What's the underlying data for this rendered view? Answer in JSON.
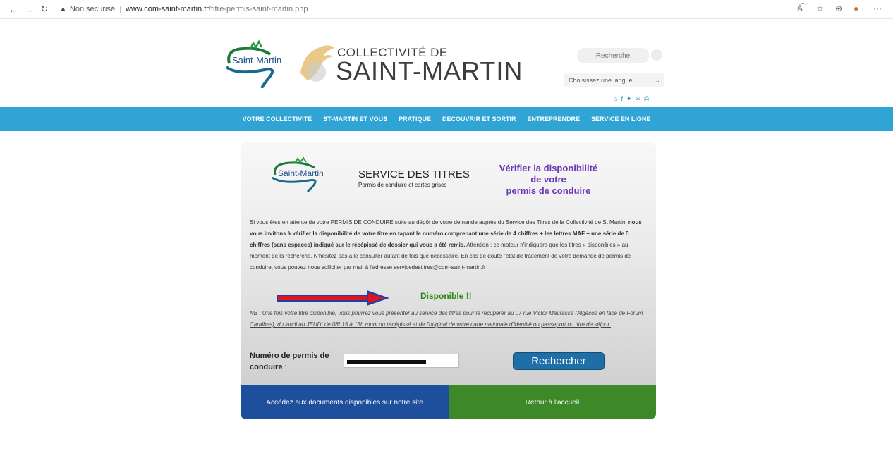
{
  "browser": {
    "security_label": "Non sécurisé",
    "url_host": "www.com-saint-martin.fr",
    "url_path": "/titre-permis-saint-martin.php",
    "icons": [
      "back-icon",
      "forward-icon",
      "refresh-icon",
      "warning-icon",
      "read-aloud-icon",
      "favorites-icon",
      "collections-icon",
      "profile-icon",
      "more-icon"
    ]
  },
  "header": {
    "logo_text": "Saint-Martin",
    "collectivite_line1": "COLLECTIVITÉ DE",
    "collectivite_line2": "SAINT-MARTIN",
    "search_placeholder": "Recherche",
    "language_label": "Choisissez une langue",
    "social_icons": [
      "home-icon",
      "facebook-icon",
      "twitter-icon",
      "mail-icon",
      "print-icon"
    ]
  },
  "nav": {
    "items": [
      "VOTRE COLLECTIVITÉ",
      "ST-MARTIN ET VOUS",
      "PRATIQUE",
      "DECOUVRIR ET SORTIR",
      "ENTREPRENDRE",
      "SERVICE EN LIGNE"
    ]
  },
  "panel": {
    "logo_text": "Saint-Martin",
    "service_title": "SERVICE DES TITRES",
    "service_subtitle": "Permis de conduire et cartes grises",
    "verify_line1": "Vérifier la disponibilité",
    "verify_line2": "de votre",
    "verify_line3": "permis de conduire",
    "intro_part1": "Si vous êtes en attente de votre PERMIS DE CONDUIRE suite au dépôt de votre demande auprès du Service des Titres de la Collectivité de St Martin, ",
    "intro_bold": "nous vous invitons à vérifier la disponibilité de votre titre en tapant le numéro comprenant une série de 4 chiffres + les lettres MAF + une série de 5 chiffres (sans espaces) indiqué sur le récépissé de dossier qui vous a été remis.",
    "intro_part2": " Attention : ce moteur n'indiquera que les titres « disponibles » au moment de la recherche. N'hésitez pas à le consulter autant de fois que nécessaire. En cas de doute l'état de traitement de votre demande de permis de conduire, vous pouvez nous solliciter par mail à l'adresse servicedestitres@com-saint-martin.fr",
    "status": "Disponible !!",
    "nb": "NB : Une fois votre titre disponible, vous pourrez vous présenter au service des titres pour le récupérer au 07 rue Victor Maurasse (Algécos en face de Forum Caraibes), du lundi au JEUDI de 08h15 à 13h muni du récépissé et de l'original de votre carte nationale d'identité ou passeport ou titre de séjour.",
    "number_label": "Numéro de permis de conduire",
    "number_suffix": " :",
    "search_button": "Rechercher",
    "docs_tile": "Accédez aux documents disponibles sur notre site",
    "home_tile": "Retour à l'accueil"
  },
  "colors": {
    "nav_blue": "#31a4d6",
    "verify_purple": "#6a35b8",
    "status_green": "#2a8a12",
    "docs_tile_blue": "#1e4f9c",
    "home_tile_green": "#3d8828",
    "arrow_red": "#e0141e"
  }
}
